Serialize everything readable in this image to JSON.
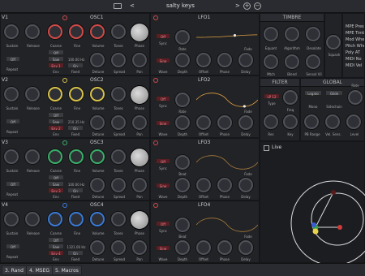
{
  "header": {
    "preset": "salty keys",
    "prev": "<",
    "next": ">"
  },
  "osc": [
    {
      "title": "OSC1",
      "vlabel": "V1",
      "color": "#d24a4a",
      "fine": "100.00 Hz",
      "btn1": "Off",
      "btn2": "Saw",
      "btn3": "Env 1",
      "btn4": "On"
    },
    {
      "title": "OSC2",
      "vlabel": "V2",
      "color": "#d8c24a",
      "fine": "210.35 Hz",
      "btn1": "Off",
      "btn2": "Saw",
      "btn3": "Env 2",
      "btn4": "On"
    },
    {
      "title": "OSC3",
      "vlabel": "V3",
      "color": "#3ab06a",
      "fine": "100.00 Hz",
      "btn1": "Off",
      "btn2": "Saw",
      "btn3": "Env 3",
      "btn4": "On"
    },
    {
      "title": "OSC4",
      "vlabel": "V4",
      "color": "#3a7ad6",
      "fine": "1321.00 Hz",
      "btn1": "Off",
      "btn2": "Saw",
      "btn3": "Env 4",
      "btn4": "On"
    }
  ],
  "labels": {
    "sustain": "Sustain",
    "release": "Release",
    "coarse": "Coarse",
    "fine": "Fine",
    "volume": "Volume",
    "tones": "Tones",
    "phase": "Phase",
    "detune": "Detune",
    "spread": "Spread",
    "pan": "Pan",
    "repeat": "Repeat",
    "env": "Env",
    "fixed": "Fixed",
    "off": "Off"
  },
  "lfo": [
    {
      "title": "LFO1",
      "sync": "Off",
      "wave": "Sine",
      "rate": "Rate",
      "depth": "Depth",
      "offset": "Offset",
      "phase": "Phase",
      "delay": "Delay",
      "fade": "Fade",
      "wlabel": "Wave",
      "slabel": "Sync"
    },
    {
      "title": "LFO2",
      "sync": "Off",
      "wave": "Sine",
      "rate": "Rate",
      "depth": "Depth",
      "offset": "Offset",
      "phase": "Phase",
      "delay": "Delay",
      "fade": "Fade",
      "wlabel": "Wave",
      "slabel": "Sync"
    },
    {
      "title": "LFO3",
      "sync": "Off",
      "wave": "Sine",
      "rate": "Beat",
      "depth": "Depth",
      "offset": "Offset",
      "phase": "Phase",
      "delay": "Delay",
      "fade": "Fade",
      "wlabel": "Wave",
      "slabel": "Sync"
    },
    {
      "title": "LFO4",
      "sync": "Off",
      "wave": "Sine",
      "rate": "Beat",
      "depth": "Depth",
      "offset": "Offset",
      "phase": "Phase",
      "delay": "Delay",
      "fade": "Fade",
      "wlabel": "Wave",
      "slabel": "Sync"
    }
  ],
  "timbre": {
    "title": "TIMBRE",
    "k1": "Equant",
    "k2": "Algorithm",
    "k3": "Desolate",
    "k4": "Squash",
    "k5": "Mtch",
    "k6": "Blend",
    "k7": "Sensol Vil"
  },
  "filter": {
    "title": "FILTER",
    "type": "LP 12",
    "tlabel": "Type",
    "freq": "Freq",
    "res": "Res",
    "key": "Key"
  },
  "global": {
    "title": "GLOBAL",
    "legato": "Legato",
    "glide": "Glide",
    "mono": "Mono",
    "sidechain": "Sidechain",
    "pbrange": "PB Range",
    "velsens": "Vel. Sens.",
    "level": "Level",
    "rate": "Rate"
  },
  "mpe": [
    "MPE Pres",
    "MPE Timb",
    "Mod Whe",
    "Pitch Whe",
    "Poly AT",
    "MIDI No",
    "MIDI Vel"
  ],
  "live": "Live",
  "tabs": [
    "3. Rand",
    "4. MSEG",
    "5. Macros"
  ]
}
